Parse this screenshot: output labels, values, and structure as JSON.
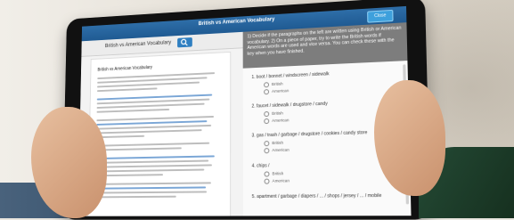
{
  "app": {
    "title": "British vs American Vocabulary",
    "close_label": "Close"
  },
  "left_panel": {
    "title": "British vs American Vocabulary",
    "doc_title": "British vs American Vocabulary"
  },
  "right_panel": {
    "instructions": "1) Decide if the paragraphs on the left are written using British or American vocabulary. 2) On a piece of paper, try to write the British words if American words are used and vice versa. You can check these with the key when you have finished.",
    "questions": [
      {
        "text": "1.  boot / bonnet / windscreen / sidewalk",
        "options": [
          "British",
          "American"
        ]
      },
      {
        "text": "2.  faucet / sidewalk / drugstore / candy",
        "options": [
          "British",
          "American"
        ]
      },
      {
        "text": "3.  gas / trash / garbage / drugstore / cookies / candy store",
        "options": [
          "British",
          "American"
        ]
      },
      {
        "text": "4.  chips / ",
        "options": [
          "British",
          "American"
        ]
      },
      {
        "text": "5.  apartment / garbage / diapers / ... / shops / jersey / ... / mobile",
        "options": []
      }
    ]
  }
}
